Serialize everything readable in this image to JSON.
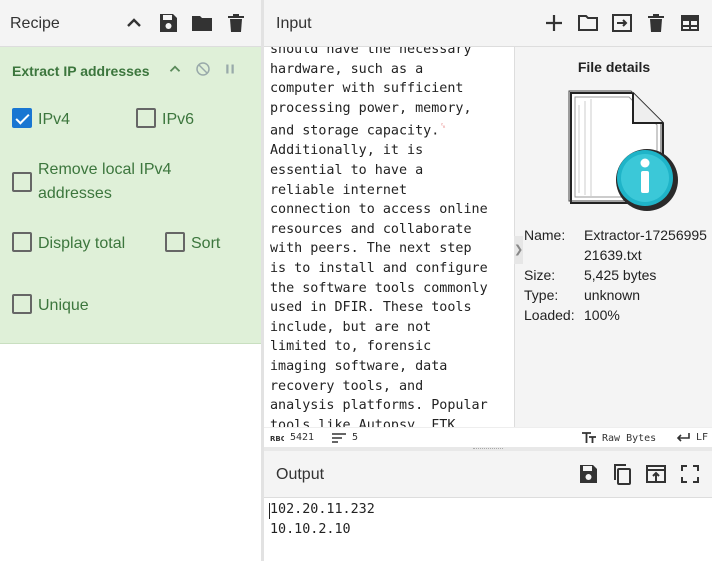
{
  "recipe": {
    "title": "Recipe",
    "operation": {
      "title": "Extract IP addresses",
      "options": [
        {
          "label": "IPv4",
          "checked": true
        },
        {
          "label": "IPv6",
          "checked": false
        },
        {
          "label": "Remove local IPv4 addresses",
          "checked": false
        },
        {
          "label": "Display total",
          "checked": false
        },
        {
          "label": "Sort",
          "checked": false
        },
        {
          "label": "Unique",
          "checked": false
        }
      ]
    }
  },
  "input": {
    "title": "Input",
    "lines": [
      "should have the necessary",
      "hardware, such as a",
      "computer with sufficient",
      "processing power, memory,",
      "and storage capacity.",
      "Additionally, it is",
      "essential to have a",
      "reliable internet",
      "connection to access online",
      "resources and collaborate",
      "with peers. The next step",
      "is to install and configure",
      "the software tools commonly",
      "used in DFIR. These tools",
      "include, but are not",
      "limited to, forensic",
      "imaging software, data",
      "recovery tools, and",
      "analysis platforms. Popular",
      "tools like Autopsy, FTK"
    ],
    "file_details": {
      "title": "File details",
      "name_label": "Name:",
      "name_value": "Extractor-1725699521639.txt",
      "size_label": "Size:",
      "size_value": "5,425 bytes",
      "type_label": "Type:",
      "type_value": "unknown",
      "loaded_label": "Loaded:",
      "loaded_value": "100%"
    },
    "status": {
      "chars": "5421",
      "lines": "5",
      "encoding": "Raw Bytes",
      "eol": "LF"
    }
  },
  "output": {
    "title": "Output",
    "lines": [
      "102.20.11.232",
      "10.10.2.10"
    ]
  },
  "colors": {
    "accent": "#1976d2",
    "op_bg": "#dff0d8",
    "op_text": "#3c763d"
  }
}
